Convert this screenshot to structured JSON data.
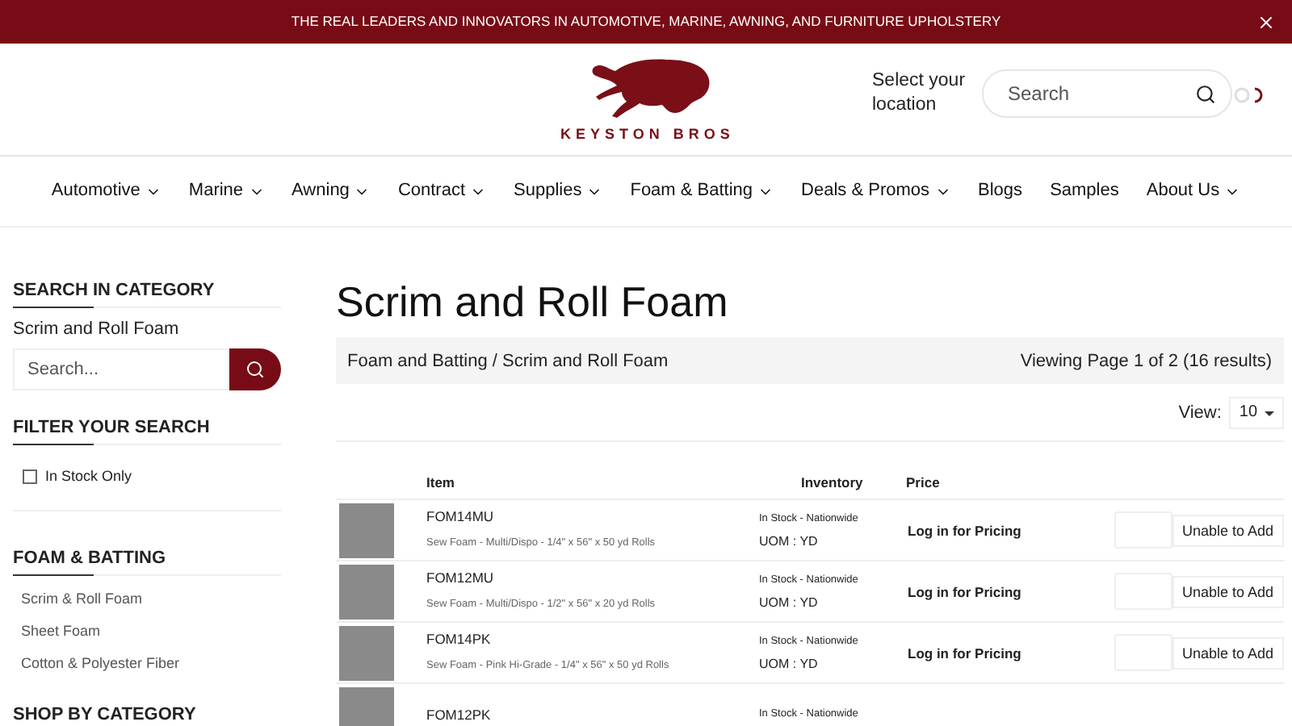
{
  "banner": {
    "text": "THE REAL LEADERS AND INNOVATORS IN AUTOMOTIVE, MARINE, AWNING, AND FURNITURE UPHOLSTERY"
  },
  "header": {
    "logo_text": "KEYSTON BROS",
    "location": "Select your location",
    "search": {
      "placeholder": "Search"
    }
  },
  "nav": [
    {
      "label": "Automotive",
      "dropdown": true
    },
    {
      "label": "Marine",
      "dropdown": true
    },
    {
      "label": "Awning",
      "dropdown": true
    },
    {
      "label": "Contract",
      "dropdown": true
    },
    {
      "label": "Supplies",
      "dropdown": true
    },
    {
      "label": "Foam & Batting",
      "dropdown": true
    },
    {
      "label": "Deals & Promos",
      "dropdown": true
    },
    {
      "label": "Blogs",
      "dropdown": false
    },
    {
      "label": "Samples",
      "dropdown": false
    },
    {
      "label": "About Us",
      "dropdown": true
    }
  ],
  "sidebar": {
    "search_heading": "SEARCH IN CATEGORY",
    "category": "Scrim and Roll Foam",
    "search": {
      "placeholder": "Search..."
    },
    "filter_heading": "FILTER YOUR SEARCH",
    "filters": [
      {
        "label": "In Stock Only",
        "checked": false
      }
    ],
    "section_heading": "FOAM & BATTING",
    "links": [
      "Scrim & Roll Foam",
      "Sheet Foam",
      "Cotton & Polyester Fiber"
    ],
    "shop_heading": "SHOP BY CATEGORY"
  },
  "page": {
    "title": "Scrim and Roll Foam",
    "breadcrumb": "Foam and Batting / Scrim and Roll Foam",
    "results": "Viewing Page 1 of 2 (16 results)",
    "view_label": "View:",
    "view_value": "10"
  },
  "table": {
    "columns": [
      "Item",
      "Inventory",
      "Price"
    ],
    "rows": [
      {
        "code": "FOM14MU",
        "description": "Sew Foam - Multi/Dispo - 1/4\" x 56\" x 50 yd Rolls",
        "stock": "In Stock - Nationwide",
        "uom": "UOM : YD",
        "price": "Log in for Pricing",
        "button": "Unable to Add"
      },
      {
        "code": "FOM12MU",
        "description": "Sew Foam - Multi/Dispo - 1/2\" x 56\" x 20 yd Rolls",
        "stock": "In Stock - Nationwide",
        "uom": "UOM : YD",
        "price": "Log in for Pricing",
        "button": "Unable to Add"
      },
      {
        "code": "FOM14PK",
        "description": "Sew Foam - Pink Hi-Grade - 1/4\" x 56\" x 50 yd Rolls",
        "stock": "In Stock - Nationwide",
        "uom": "UOM : YD",
        "price": "Log in for Pricing",
        "button": "Unable to Add"
      },
      {
        "code": "FOM12PK",
        "stock": "In Stock - Nationwide"
      }
    ]
  }
}
